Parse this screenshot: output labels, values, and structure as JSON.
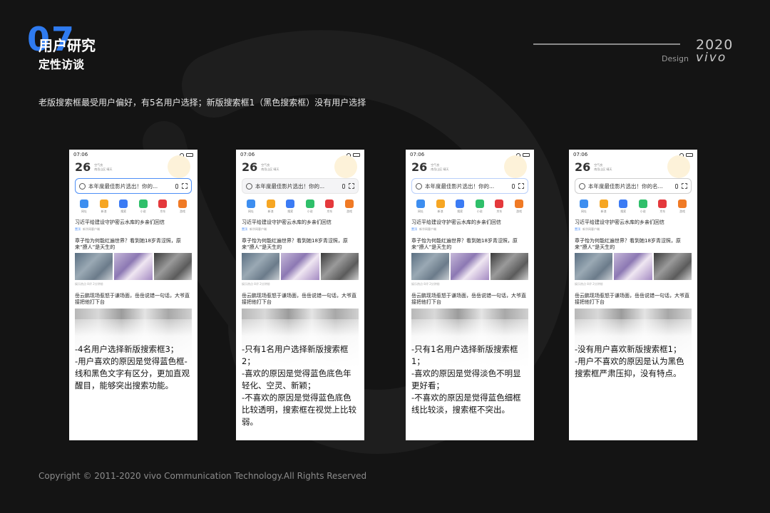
{
  "header": {
    "number": "07",
    "title": "用户研究",
    "subtitle": "定性访谈",
    "year": "2020",
    "design_label": "Design",
    "brand": "vivo"
  },
  "summary": "老版搜索框最受用户偏好，有5名用户选择；新版搜索框1（黑色搜索框）没有用户选择",
  "footer": "Copyright © 2011-2020 vivo Communication Technology.All Rights Reserved",
  "phone_common": {
    "time": "07:06",
    "temperature": "26",
    "weather_text": "空气良",
    "weather_loc": "南岳山区 晴天",
    "apps": [
      {
        "label": "网址",
        "color": "#3d8ef0"
      },
      {
        "label": "新浪",
        "color": "#f6a623"
      },
      {
        "label": "搜索",
        "color": "#3b7bf4"
      },
      {
        "label": "小说",
        "color": "#2fbf6a"
      },
      {
        "label": "京东",
        "color": "#e4393c"
      },
      {
        "label": "游戏",
        "color": "#f07a25"
      }
    ],
    "news1": "习近平给建设守护密云水库的乡亲们回信",
    "news1_tag": "置顶",
    "news1_src": "新华网客户端",
    "news2": "章子怡为何能红遍世界？看到她18岁青涩照，原来“撩人”是天生的",
    "news2_meta": "娱乐热点  8评  2分钟前",
    "news3": "岳云鹏现场惹怒于谦场面，岳岳说错一句话，大爷直接把他打下台"
  },
  "phones": [
    {
      "search_text": "本年度最佳影片选出！你的...",
      "style": "style-blue",
      "note": [
        "-4名用户选择新版搜索框3；",
        "-用户喜欢的原因是觉得蓝色框-线和黑色文字有区分，更加直观醒目，能够突出搜索功能。"
      ]
    },
    {
      "search_text": "本年度最佳影片选出！你的...",
      "style": "style-light",
      "note": [
        "-只有1名用户选择新版搜索框2；",
        "-喜欢的原因是觉得蓝色底色年轻化、空灵、新颖；",
        "-不喜欢的原因是觉得蓝色底色比较透明，搜索框在视觉上比较弱。"
      ]
    },
    {
      "search_text": "本年度最佳影片选出！你的...",
      "style": "style-thin",
      "note": [
        "-只有1名用户选择新版搜索框1；",
        "-喜欢的原因是觉得淡色不明显更好看；",
        "-不喜欢的原因是觉得蓝色细框线比较淡，搜索框不突出。"
      ]
    },
    {
      "search_text": "本年度最佳影片选出！你的名...",
      "style": "style-gray",
      "note": [
        "-没有用户喜欢新版搜索框1；",
        "-用户不喜欢的原因是认为黑色搜索框严肃压抑，没有特点。"
      ]
    }
  ]
}
